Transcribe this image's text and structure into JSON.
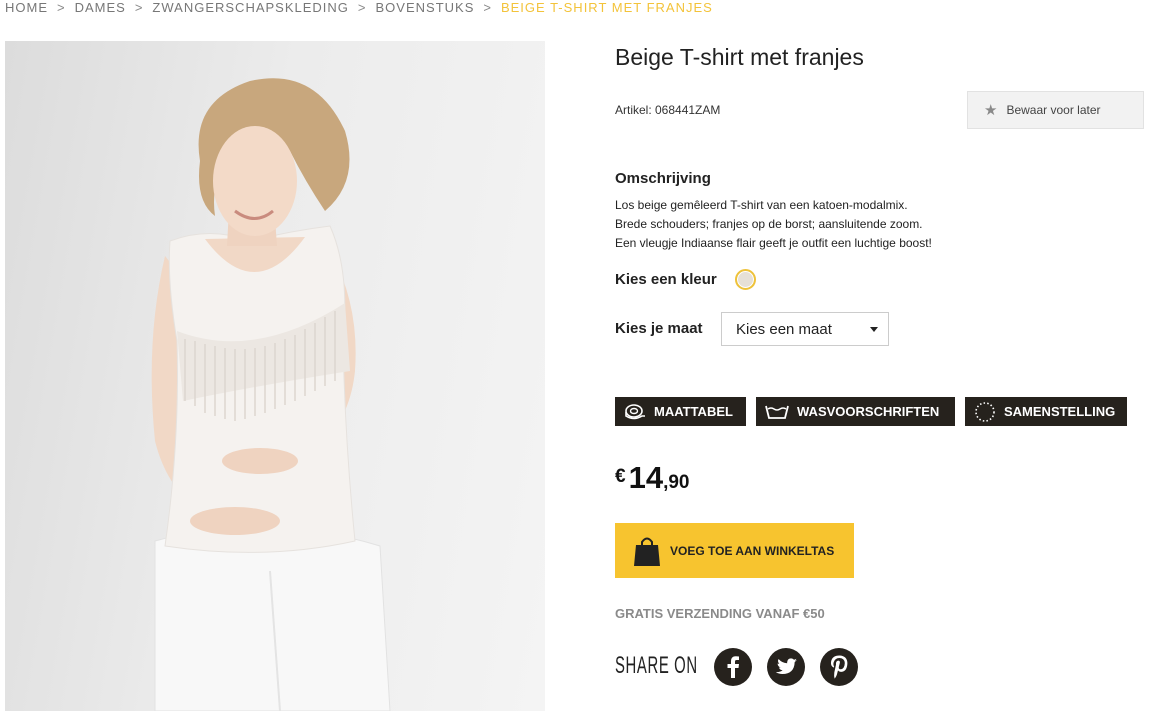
{
  "breadcrumb": {
    "items": [
      "HOME",
      "DAMES",
      "ZWANGERSCHAPSKLEDING",
      "BOVENSTUKS"
    ],
    "separator": ">",
    "current": "BEIGE T-SHIRT MET FRANJES"
  },
  "product": {
    "title": "Beige T-shirt met franjes",
    "article": "Artikel: 068441ZAM",
    "save_label": "Bewaar voor later",
    "description_title": "Omschrijving",
    "description_lines": [
      "Los beige gemêleerd T-shirt van een katoen-modalmix.",
      "Brede schouders; franjes op de borst; aansluitende zoom.",
      "Een vleugje Indiaanse flair geeft je outfit een luchtige boost!"
    ],
    "color_label": "Kies een kleur",
    "color_swatch": "#e6e0d6",
    "size_label": "Kies je maat",
    "size_select_value": "Kies een maat",
    "info_buttons": {
      "sizechart": "MAATTABEL",
      "care": "WASVOORSCHRIFTEN",
      "composition": "SAMENSTELLING"
    },
    "price": {
      "currency": "€",
      "integer": "14",
      "decimal": ",90"
    },
    "add_to_cart": "VOEG TOE AAN WINKELTAS",
    "free_shipping": "GRATIS VERZENDING VANAF €50",
    "share_label": "SHARE ON"
  },
  "social_icons": [
    "facebook-icon",
    "twitter-icon",
    "pinterest-icon"
  ],
  "colors": {
    "accent_yellow": "#f7c42f",
    "breadcrumb_current": "#f3c33a",
    "dark_button": "#26221d"
  }
}
